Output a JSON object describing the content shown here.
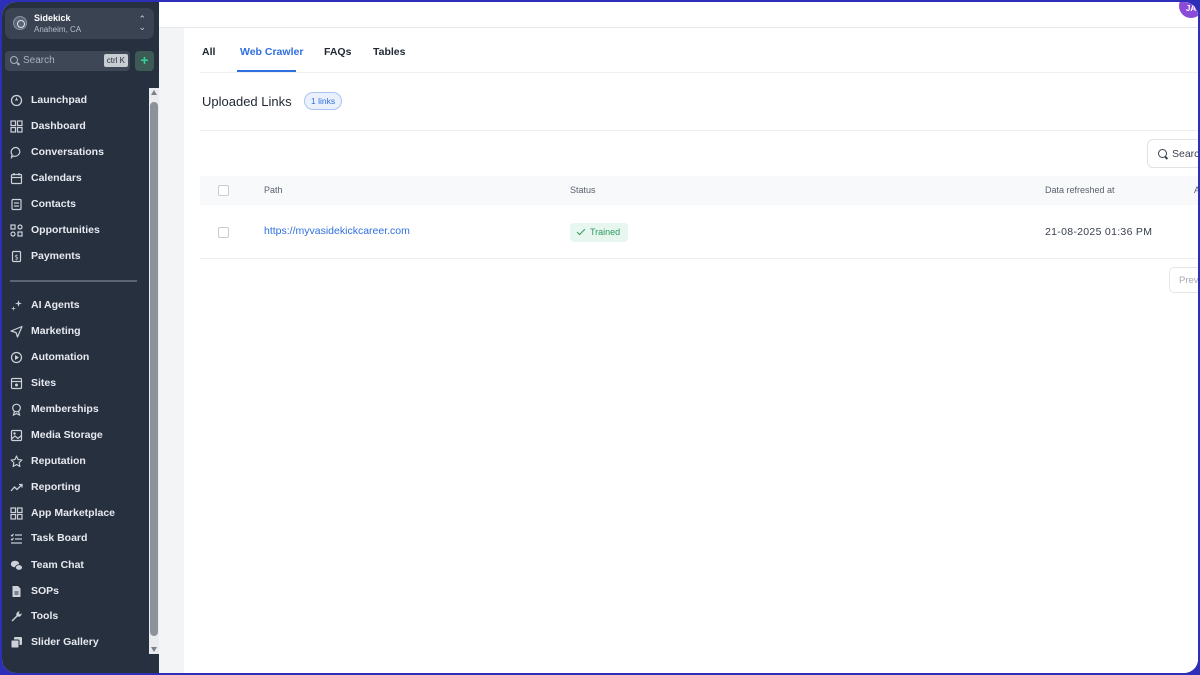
{
  "account": {
    "name": "Sidekick",
    "location": "Anaheim, CA"
  },
  "sidebar_search": {
    "placeholder": "Search",
    "shortcut": "ctrl K"
  },
  "nav_primary": [
    {
      "label": "Launchpad",
      "icon": "rocket-icon"
    },
    {
      "label": "Dashboard",
      "icon": "grid-icon"
    },
    {
      "label": "Conversations",
      "icon": "chat-icon"
    },
    {
      "label": "Calendars",
      "icon": "calendar-icon"
    },
    {
      "label": "Contacts",
      "icon": "contacts-icon"
    },
    {
      "label": "Opportunities",
      "icon": "opportunities-icon"
    },
    {
      "label": "Payments",
      "icon": "payments-icon"
    }
  ],
  "nav_secondary": [
    {
      "label": "AI Agents",
      "icon": "sparkle-icon"
    },
    {
      "label": "Marketing",
      "icon": "send-icon"
    },
    {
      "label": "Automation",
      "icon": "automation-icon"
    },
    {
      "label": "Sites",
      "icon": "sites-icon"
    },
    {
      "label": "Memberships",
      "icon": "award-icon"
    },
    {
      "label": "Media Storage",
      "icon": "image-icon"
    },
    {
      "label": "Reputation",
      "icon": "star-icon"
    },
    {
      "label": "Reporting",
      "icon": "trend-icon"
    },
    {
      "label": "App Marketplace",
      "icon": "apps-icon"
    },
    {
      "label": "Task Board",
      "icon": "tasks-icon"
    },
    {
      "label": "Team Chat",
      "icon": "team-chat-icon"
    },
    {
      "label": "SOPs",
      "icon": "document-icon"
    },
    {
      "label": "Tools",
      "icon": "wrench-icon"
    },
    {
      "label": "Slider Gallery",
      "icon": "gallery-icon"
    }
  ],
  "top_badge": "JA",
  "tabs": [
    {
      "label": "All",
      "active": false
    },
    {
      "label": "Web Crawler",
      "active": true
    },
    {
      "label": "FAQs",
      "active": false
    },
    {
      "label": "Tables",
      "active": false
    }
  ],
  "section": {
    "title": "Uploaded Links",
    "count_badge": "1 links"
  },
  "table_search": {
    "placeholder": "Search"
  },
  "table": {
    "columns": [
      "Path",
      "Status",
      "Data refreshed at",
      "A"
    ],
    "rows": [
      {
        "path": "https://myvasidekickcareer.com",
        "status": "Trained",
        "refreshed": "21-08-2025 01:36 PM"
      }
    ]
  },
  "pagination": {
    "prev_label": "Prev"
  },
  "colors": {
    "accent": "#2f6fde",
    "sidebar_bg": "#27303f",
    "success": "#2d9b5f",
    "frame": "#2d2fb8"
  }
}
